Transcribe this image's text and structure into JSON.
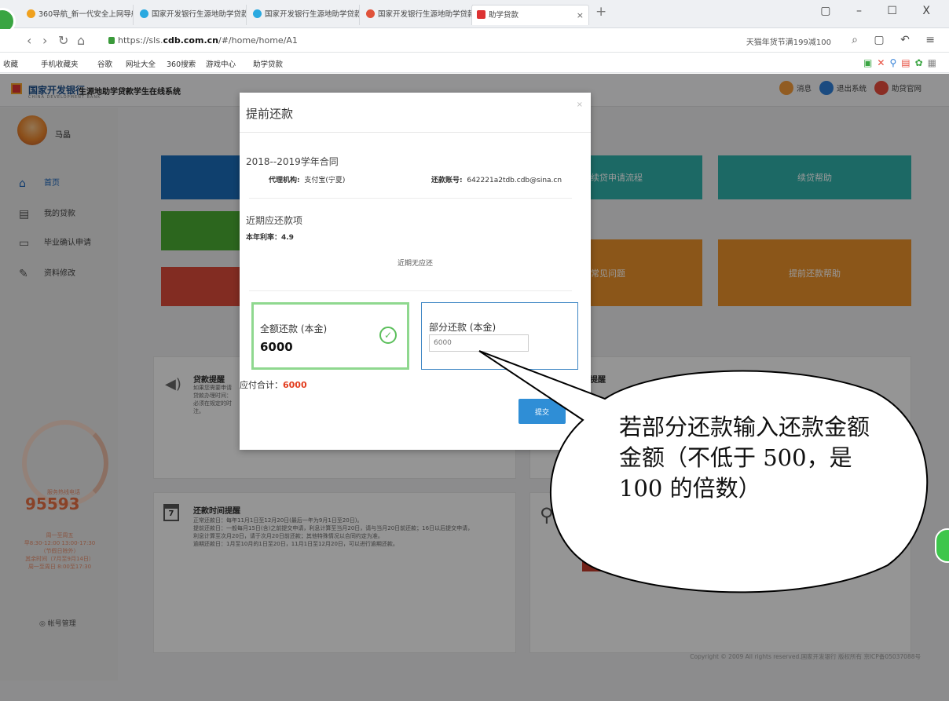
{
  "browser": {
    "tabs": [
      {
        "label": "360导航_新一代安全上网导航",
        "color": "#f0a11e"
      },
      {
        "label": "国家开发银行生源地助学贷款系",
        "color": "#2aa9e0"
      },
      {
        "label": "国家开发银行生源地助学贷款系",
        "color": "#2aa9e0"
      },
      {
        "label": "国家开发银行生源地助学贷款系",
        "color": "#e0523a"
      },
      {
        "label": "助学贷款",
        "color": "#d33"
      }
    ],
    "url_prefix": "https://sls.",
    "url_host": "cdb.com.cn",
    "url_path": "/#/home/home/A1",
    "search_hint": "天猫年货节满199减100",
    "window_controls": "▢ – ☐ X",
    "favorites": [
      "收藏",
      "手机收藏夹",
      "谷歌",
      "网址大全",
      "360搜索",
      "游戏中心",
      "助学贷款"
    ]
  },
  "header": {
    "bank_name": "国家开发银行",
    "bank_sub": "CHINA DEVELOPMENT BANK",
    "system_name": "生源地助学贷款学生在线系统",
    "messages": "消息",
    "logout": "退出系统",
    "official_site": "助贷官网"
  },
  "sidebar": {
    "username": "马晶",
    "items": [
      {
        "label": "首页",
        "icon": "home-icon"
      },
      {
        "label": "我的贷款",
        "icon": "document-icon"
      },
      {
        "label": "毕业确认申请",
        "icon": "monitor-icon"
      },
      {
        "label": "资料修改",
        "icon": "edit-icon"
      }
    ],
    "hotline_label": "服务热线电话",
    "hotline": "95593",
    "hotline_hours": [
      "周一至周五",
      "早8:30-12:00 13:00-17:30",
      "（节假日除外）",
      "其余时间（7月至9月14日）",
      "周一至周日 8:00至17:30"
    ],
    "account_manage": "帐号管理"
  },
  "tiles": [
    {
      "label": "",
      "color": "#1a6bb8"
    },
    {
      "label": "续贷申请流程",
      "color": "#2fb0a8"
    },
    {
      "label": "续贷帮助",
      "color": "#2fb0a8"
    },
    {
      "label": "",
      "color": "#4aaa32"
    },
    {
      "label": "",
      "color": "#d94a3a"
    },
    {
      "label": "常见问题",
      "color": "#e8902a"
    },
    {
      "label": "提前还款帮助",
      "color": "#e8902a"
    }
  ],
  "cards": {
    "loan_reminder_title": "贷款提醒",
    "loan_reminder_text": [
      "如果您需要申请",
      "贷款办理时间：",
      "必须在规定的时",
      "注。"
    ],
    "right_reminder_title": "提醒",
    "time_reminder_title": "还款时间提醒",
    "time_reminder_lines": [
      "正常还款日：每年11月1日至12月20日(最后一年为9月1日至20日)。",
      "提前还款日：一般每月15日(含)之前提交申请，利息计算至当月20日，请与当月20日前还款；16日以后提交申请，",
      "利息计算至次月20日，请于次月20日前还款；其他特殊情况以合同约定为准。",
      "逾期还款日：1月至10月的1日至20日，11月1日至12月20日，可以进行逾期还款。"
    ],
    "calendar_day": "7",
    "copyright": "Copyright © 2009 All rights reserved.国家开发银行 版权所有 京ICP备05037088号"
  },
  "modal": {
    "title": "提前还款",
    "close": "×",
    "contract": "2018--2019学年合同",
    "agency_label": "代理机构:",
    "agency_value": "支付宝(宁夏)",
    "account_label": "还款账号:",
    "account_value": "642221a2tdb.cdb@sina.cn",
    "recent_title": "近期应还款项",
    "rate": "本年利率：4.9",
    "no_due": "近期无应还",
    "full_label": "全额还款 (本金)",
    "full_value": "6000",
    "partial_label": "部分还款 (本金)",
    "partial_placeholder": "6000",
    "total_label": "应付合计：",
    "total_value": "6000",
    "submit": "提交"
  },
  "callout": {
    "text": "若部分还款输入还款金额金额（不低于 500，是 100 的倍数）"
  }
}
